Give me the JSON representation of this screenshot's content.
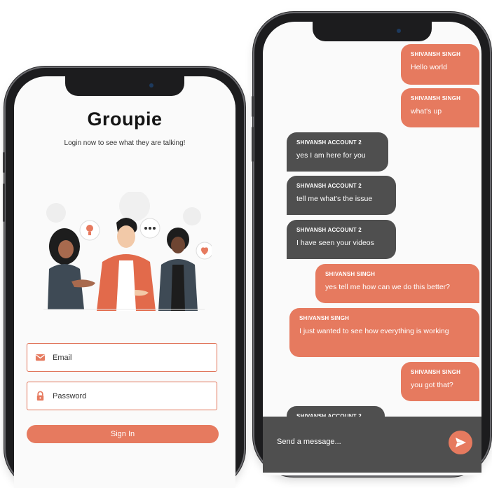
{
  "login": {
    "title": "Groupie",
    "subtitle": "Login now to see what they are talking!",
    "email": {
      "placeholder": "Email",
      "icon": "mail-icon"
    },
    "password": {
      "placeholder": "Password",
      "icon": "lock-icon"
    },
    "signin_label": "Sign In"
  },
  "chat": {
    "messages": [
      {
        "sender": "SHIVANSH SINGH",
        "text": "Hello world",
        "mine": true
      },
      {
        "sender": "SHIVANSH SINGH",
        "text": "what's up",
        "mine": true
      },
      {
        "sender": "SHIVANSH ACCOUNT 2",
        "text": "yes I am here for you",
        "mine": false
      },
      {
        "sender": "SHIVANSH ACCOUNT 2",
        "text": "tell me what's the issue",
        "mine": false
      },
      {
        "sender": "SHIVANSH ACCOUNT 2",
        "text": "I have seen your videos",
        "mine": false
      },
      {
        "sender": "SHIVANSH SINGH",
        "text": "yes tell me how can we do this better?",
        "mine": true
      },
      {
        "sender": "SHIVANSH SINGH",
        "text": "I just wanted to see how everything is working",
        "mine": true
      },
      {
        "sender": "SHIVANSH SINGH",
        "text": "you got that?",
        "mine": true
      },
      {
        "sender": "SHIVANSH ACCOUNT 2",
        "text": "",
        "mine": false
      }
    ],
    "composer_placeholder": "Send a message...",
    "send_icon": "send-icon"
  },
  "colors": {
    "accent": "#e67a5f",
    "dark_bubble": "#4f4f4f",
    "frame": "#1c1c1e"
  }
}
